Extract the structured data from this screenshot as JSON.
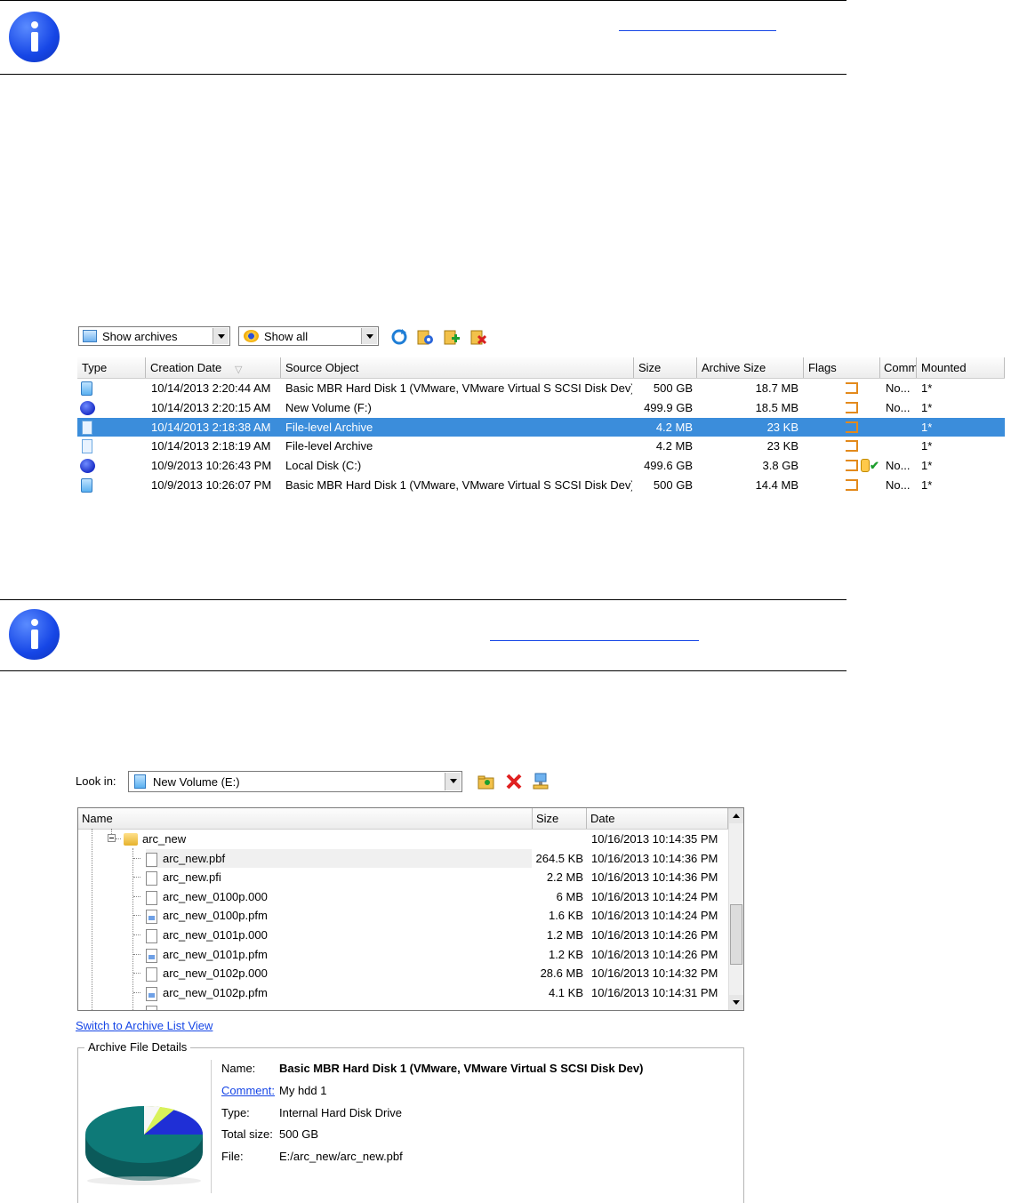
{
  "colors": {
    "accent_blue": "#1646e6",
    "selection": "#3b8ddb",
    "flag_orange": "#e38a1c",
    "pie_teal": "#0e6f6f"
  },
  "toolbar": {
    "show_archives": "Show archives",
    "show_all": "Show all",
    "icons": [
      "refresh-icon",
      "archive-settings-icon",
      "add-archive-icon",
      "delete-archive-icon"
    ]
  },
  "archive_list": {
    "columns": [
      "Type",
      "Creation Date",
      "Source Object",
      "Size",
      "Archive Size",
      "Flags",
      "Comm",
      "Mounted"
    ],
    "rows": [
      {
        "type": "hdd",
        "date": "10/14/2013 2:20:44 AM",
        "source": "Basic MBR Hard Disk 1 (VMware, VMware Virtual S SCSI Disk Dev)",
        "size": "500 GB",
        "archive_size": "18.7 MB",
        "comment": "No...",
        "mounted": "1*"
      },
      {
        "type": "volume",
        "date": "10/14/2013 2:20:15 AM",
        "source": "New Volume (F:)",
        "size": "499.9 GB",
        "archive_size": "18.5 MB",
        "comment": "No...",
        "mounted": "1*"
      },
      {
        "type": "file",
        "date": "10/14/2013 2:18:38 AM",
        "source": "File-level Archive",
        "size": "4.2 MB",
        "archive_size": "23 KB",
        "comment": "",
        "mounted": "1*",
        "selected": true
      },
      {
        "type": "file",
        "date": "10/14/2013 2:18:19 AM",
        "source": "File-level Archive",
        "size": "4.2 MB",
        "archive_size": "23 KB",
        "comment": "",
        "mounted": "1*"
      },
      {
        "type": "volume",
        "date": "10/9/2013 10:26:43 PM",
        "source": "Local Disk (C:)",
        "size": "499.6 GB",
        "archive_size": "3.8 GB",
        "comment": "No...",
        "mounted": "1*"
      },
      {
        "type": "hdd",
        "date": "10/9/2013 10:26:07 PM",
        "source": "Basic MBR Hard Disk 1 (VMware, VMware Virtual S SCSI Disk Dev)",
        "size": "500 GB",
        "archive_size": "14.4 MB",
        "comment": "No...",
        "mounted": "1*"
      }
    ]
  },
  "browser": {
    "look_in_label": "Look in:",
    "look_in_value": "New Volume (E:)",
    "columns": [
      "Name",
      "Size",
      "Date"
    ],
    "folder": {
      "name": "arc_new",
      "date": "10/16/2013 10:14:35 PM"
    },
    "files": [
      {
        "name": "arc_new.pbf",
        "size": "264.5 KB",
        "date": "10/16/2013 10:14:36 PM",
        "kind": "file"
      },
      {
        "name": "arc_new.pfi",
        "size": "2.2 MB",
        "date": "10/16/2013 10:14:36 PM",
        "kind": "file"
      },
      {
        "name": "arc_new_0100p.000",
        "size": "6 MB",
        "date": "10/16/2013 10:14:24 PM",
        "kind": "file"
      },
      {
        "name": "arc_new_0100p.pfm",
        "size": "1.6 KB",
        "date": "10/16/2013 10:14:24 PM",
        "kind": "pfm"
      },
      {
        "name": "arc_new_0101p.000",
        "size": "1.2 MB",
        "date": "10/16/2013 10:14:26 PM",
        "kind": "file"
      },
      {
        "name": "arc_new_0101p.pfm",
        "size": "1.2 KB",
        "date": "10/16/2013 10:14:26 PM",
        "kind": "pfm"
      },
      {
        "name": "arc_new_0102p.000",
        "size": "28.6 MB",
        "date": "10/16/2013 10:14:32 PM",
        "kind": "file"
      },
      {
        "name": "arc_new_0102p.pfm",
        "size": "4.1 KB",
        "date": "10/16/2013 10:14:31 PM",
        "kind": "pfm"
      }
    ],
    "switch_link": "Switch to Archive List View"
  },
  "details": {
    "legend": "Archive File Details",
    "name_label": "Name:",
    "name_value": "Basic MBR Hard Disk 1 (VMware, VMware Virtual S SCSI Disk Dev)",
    "comment_label": "Comment:",
    "comment_value": "My hdd 1",
    "type_label": "Type:",
    "type_value": "Internal Hard Disk Drive",
    "total_label": "Total size:",
    "total_value": "500 GB",
    "file_label": "File:",
    "file_value": "E:/arc_new/arc_new.pbf"
  }
}
